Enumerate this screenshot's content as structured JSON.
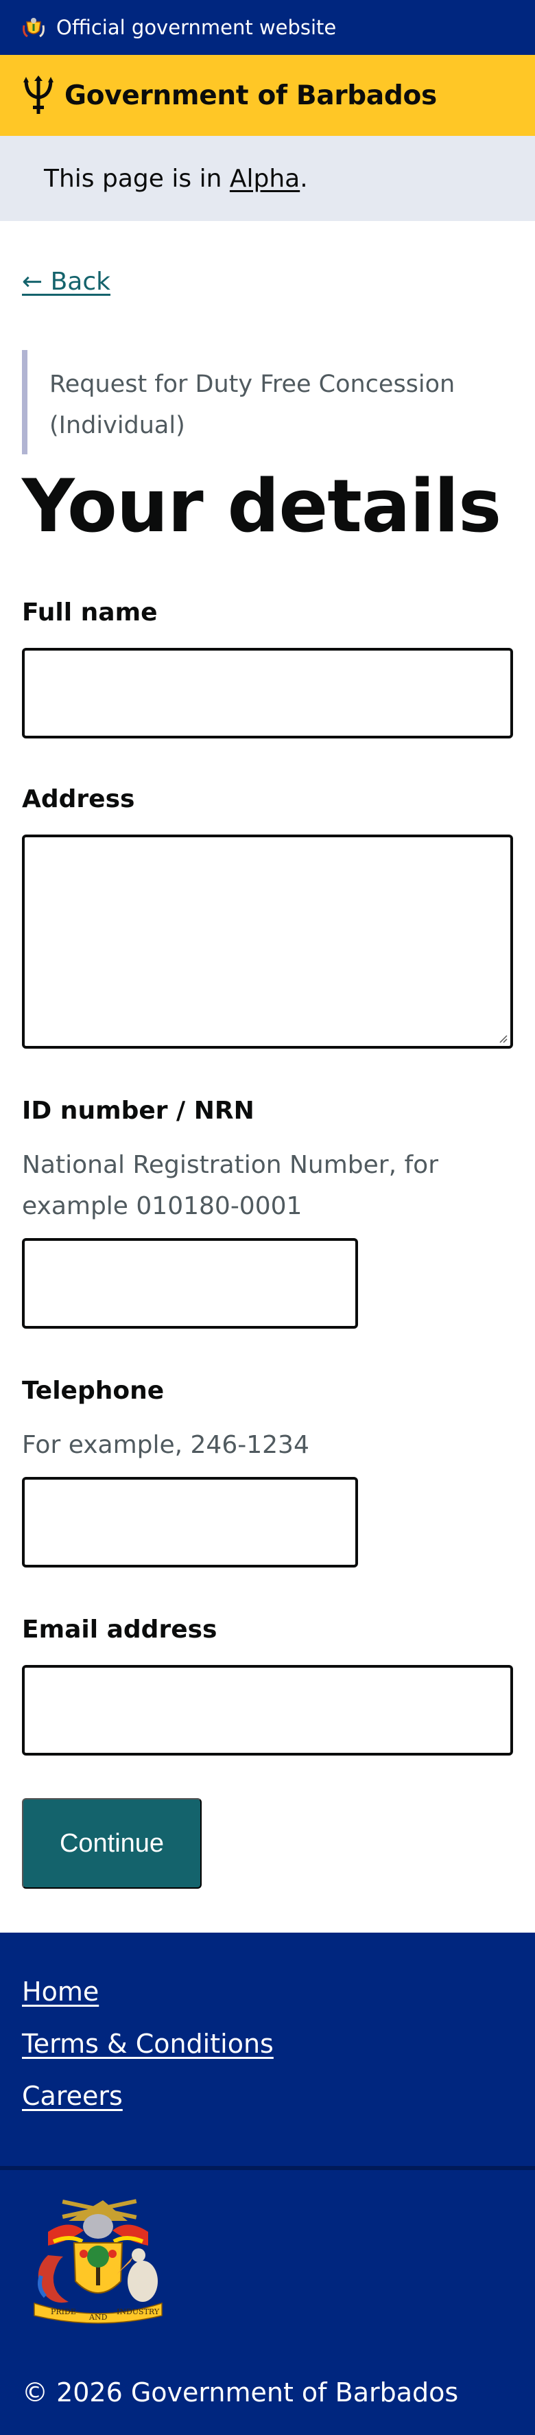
{
  "header": {
    "official_text": "Official government website",
    "brand_name": "Government of Barbados",
    "colors": {
      "navy": "#00267f",
      "gold": "#ffc726",
      "teal": "#14636c"
    }
  },
  "phase_banner": {
    "prefix": "This page is in ",
    "phase_link": "Alpha",
    "suffix": "."
  },
  "back_link": "← Back",
  "caption": "Request for Duty Free Concession (Individual)",
  "page_title": "Your details",
  "form": {
    "full_name": {
      "label": "Full name",
      "value": ""
    },
    "address": {
      "label": "Address",
      "value": ""
    },
    "id_number": {
      "label": "ID number / NRN",
      "hint": "National Registration Number, for example 010180-0001",
      "value": ""
    },
    "telephone": {
      "label": "Telephone",
      "hint": "For example, 246-1234",
      "value": ""
    },
    "email": {
      "label": "Email address",
      "value": ""
    }
  },
  "continue_label": "Continue",
  "footer": {
    "links": [
      "Home",
      "Terms & Conditions",
      "Careers"
    ],
    "motto": {
      "left": "PRIDE",
      "middle": "AND",
      "right": "INDUSTRY"
    },
    "copyright": "© 2026 Government of Barbados"
  }
}
